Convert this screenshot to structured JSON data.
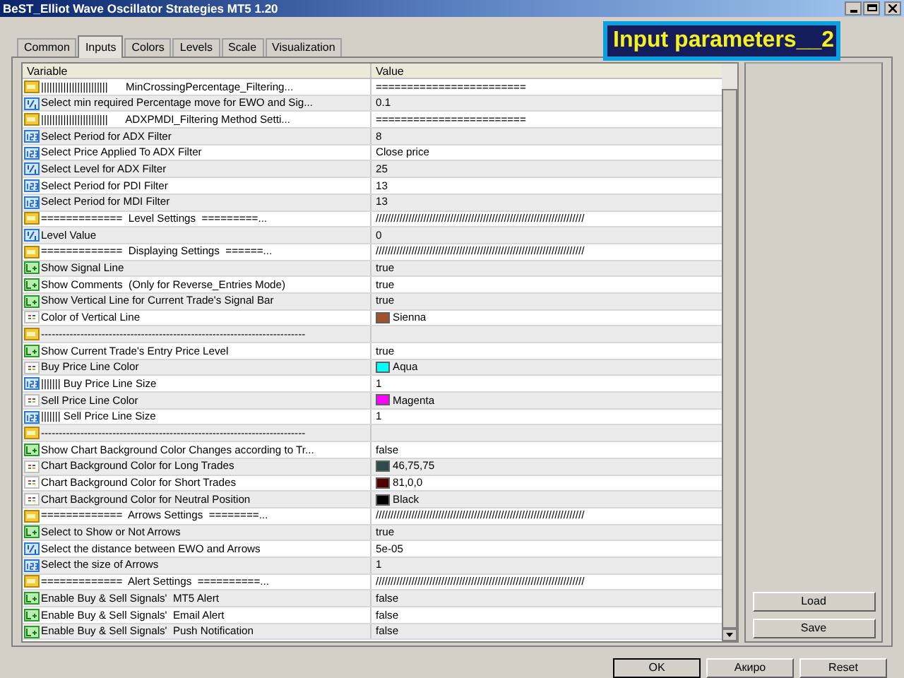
{
  "window": {
    "title": "BeST_Elliot Wave Oscillator Strategies MT5 1.20"
  },
  "tabs": [
    {
      "label": "Common",
      "selected": false
    },
    {
      "label": "Inputs",
      "selected": true
    },
    {
      "label": "Colors",
      "selected": false
    },
    {
      "label": "Levels",
      "selected": false
    },
    {
      "label": "Scale",
      "selected": false
    },
    {
      "label": "Visualization",
      "selected": false
    }
  ],
  "overlay_label": "Input parameters__2",
  "table": {
    "columns": [
      "Variable",
      "Value"
    ],
    "rows": [
      {
        "kind": "string",
        "variable": "||||||||||||||||||||||||      MinCrossingPercentage_Filtering...",
        "value": "========================"
      },
      {
        "kind": "double",
        "variable": "Select min required Percentage move for EWO and Sig...",
        "value": "0.1"
      },
      {
        "kind": "string",
        "variable": "||||||||||||||||||||||||      ADXPMDI_Filtering Method Setti...",
        "value": "========================"
      },
      {
        "kind": "int",
        "variable": "Select Period for ADX Filter",
        "value": "8"
      },
      {
        "kind": "int",
        "variable": "Select Price Applied To ADX Filter",
        "value": "Close price"
      },
      {
        "kind": "double",
        "variable": "Select Level for ADX Filter",
        "value": "25"
      },
      {
        "kind": "int",
        "variable": "Select Period for PDI Filter",
        "value": "13"
      },
      {
        "kind": "int",
        "variable": "Select Period for MDI Filter",
        "value": "13"
      },
      {
        "kind": "string",
        "variable": "=============  Level Settings  =========...",
        "value": "//////////////////////////////////////////////////////////////////////"
      },
      {
        "kind": "double",
        "variable": "Level Value",
        "value": "0"
      },
      {
        "kind": "string",
        "variable": "=============  Displaying Settings  ======...",
        "value": "//////////////////////////////////////////////////////////////////////"
      },
      {
        "kind": "bool",
        "variable": "Show Signal Line",
        "value": "true"
      },
      {
        "kind": "bool",
        "variable": "Show Comments  (Only for Reverse_Entries Mode)",
        "value": "true"
      },
      {
        "kind": "bool",
        "variable": "Show Vertical Line for Current Trade's Signal Bar",
        "value": "true"
      },
      {
        "kind": "color",
        "variable": "Color of Vertical Line",
        "value": "Sienna",
        "color": "#a0522d"
      },
      {
        "kind": "string",
        "variable": "--------------------------------------------------------------------------"
      },
      {
        "kind": "bool",
        "variable": "Show Current Trade's Entry Price Level",
        "value": "true"
      },
      {
        "kind": "color",
        "variable": "Buy Price Line Color",
        "value": "Aqua",
        "color": "#00ffff"
      },
      {
        "kind": "int",
        "variable": "||||||| Buy Price Line Size",
        "value": "1"
      },
      {
        "kind": "color",
        "variable": "Sell Price Line Color",
        "value": "Magenta",
        "color": "#ff00ff"
      },
      {
        "kind": "int",
        "variable": "||||||| Sell Price Line Size",
        "value": "1"
      },
      {
        "kind": "string",
        "variable": "--------------------------------------------------------------------------"
      },
      {
        "kind": "bool",
        "variable": "Show Chart Background Color Changes according to Tr...",
        "value": "false"
      },
      {
        "kind": "color",
        "variable": "Chart Background Color for Long Trades",
        "value": "46,75,75",
        "color": "#2e4b4b"
      },
      {
        "kind": "color",
        "variable": "Chart Background Color for Short Trades",
        "value": "81,0,0",
        "color": "#510000"
      },
      {
        "kind": "color",
        "variable": "Chart Background Color for Neutral Position",
        "value": "Black",
        "color": "#000000"
      },
      {
        "kind": "string",
        "variable": "=============  Arrows Settings  ========...",
        "value": "//////////////////////////////////////////////////////////////////////"
      },
      {
        "kind": "bool",
        "variable": "Select to Show or Not Arrows",
        "value": "true"
      },
      {
        "kind": "double",
        "variable": "Select the distance between EWO and Arrows",
        "value": "5e-05"
      },
      {
        "kind": "int",
        "variable": "Select the size of Arrows",
        "value": "1"
      },
      {
        "kind": "string",
        "variable": "=============  Alert Settings  ==========...",
        "value": "//////////////////////////////////////////////////////////////////////"
      },
      {
        "kind": "bool",
        "variable": "Enable Buy & Sell Signals'  MT5 Alert",
        "value": "false"
      },
      {
        "kind": "bool",
        "variable": "Enable Buy & Sell Signals'  Email Alert",
        "value": "false"
      },
      {
        "kind": "bool",
        "variable": "Enable Buy & Sell Signals'  Push Notification",
        "value": "false"
      }
    ]
  },
  "side_buttons": [
    "Load",
    "Save"
  ],
  "buttons": [
    "OK",
    "Акиро",
    "Reset"
  ]
}
